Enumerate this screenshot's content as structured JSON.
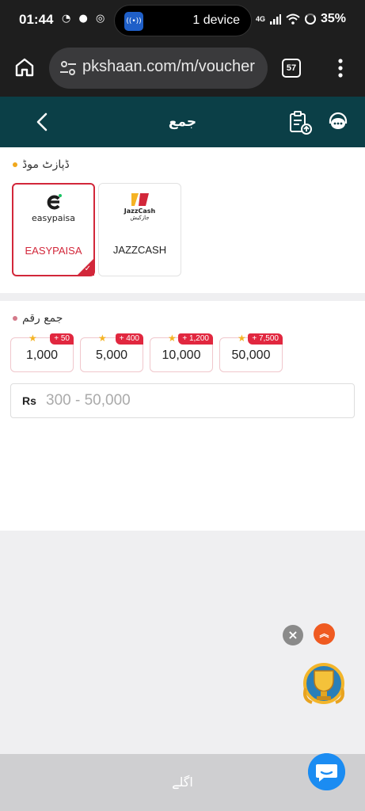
{
  "status_bar": {
    "time": "01:44",
    "notification_icons": "◔ ● ◎",
    "island_icon_text": "((•))",
    "island_text": "1 device",
    "network": "4G",
    "battery": "35%"
  },
  "browser": {
    "url": "pkshaan.com/m/voucher",
    "tab_count": "57"
  },
  "header": {
    "title": "جمع"
  },
  "deposit_mode": {
    "label": "ڈپازٹ موڈ",
    "methods": [
      {
        "name": "EASYPAISA",
        "logo_text": "easypaisa",
        "selected": true,
        "name_color": "#d2273a"
      },
      {
        "name": "JAZZCASH",
        "logo_text": "JazzCash",
        "logo_subtext": "جازکیش",
        "selected": false,
        "name_color": "#222222"
      }
    ]
  },
  "deposit_amount": {
    "label": "جمع رقم",
    "presets": [
      {
        "value": "1,000",
        "bonus": "+ 50"
      },
      {
        "value": "5,000",
        "bonus": "+ 400"
      },
      {
        "value": "10,000",
        "bonus": "+ 1,200"
      },
      {
        "value": "50,000",
        "bonus": "+ 7,500"
      }
    ],
    "currency": "Rs",
    "placeholder": "300 - 50,000"
  },
  "footer": {
    "next_label": "اگلے"
  },
  "colors": {
    "header_bg": "#0b3f47",
    "accent_red": "#d2273a",
    "chat_blue": "#1b8cf2",
    "scroll_orange": "#ef5a21"
  }
}
